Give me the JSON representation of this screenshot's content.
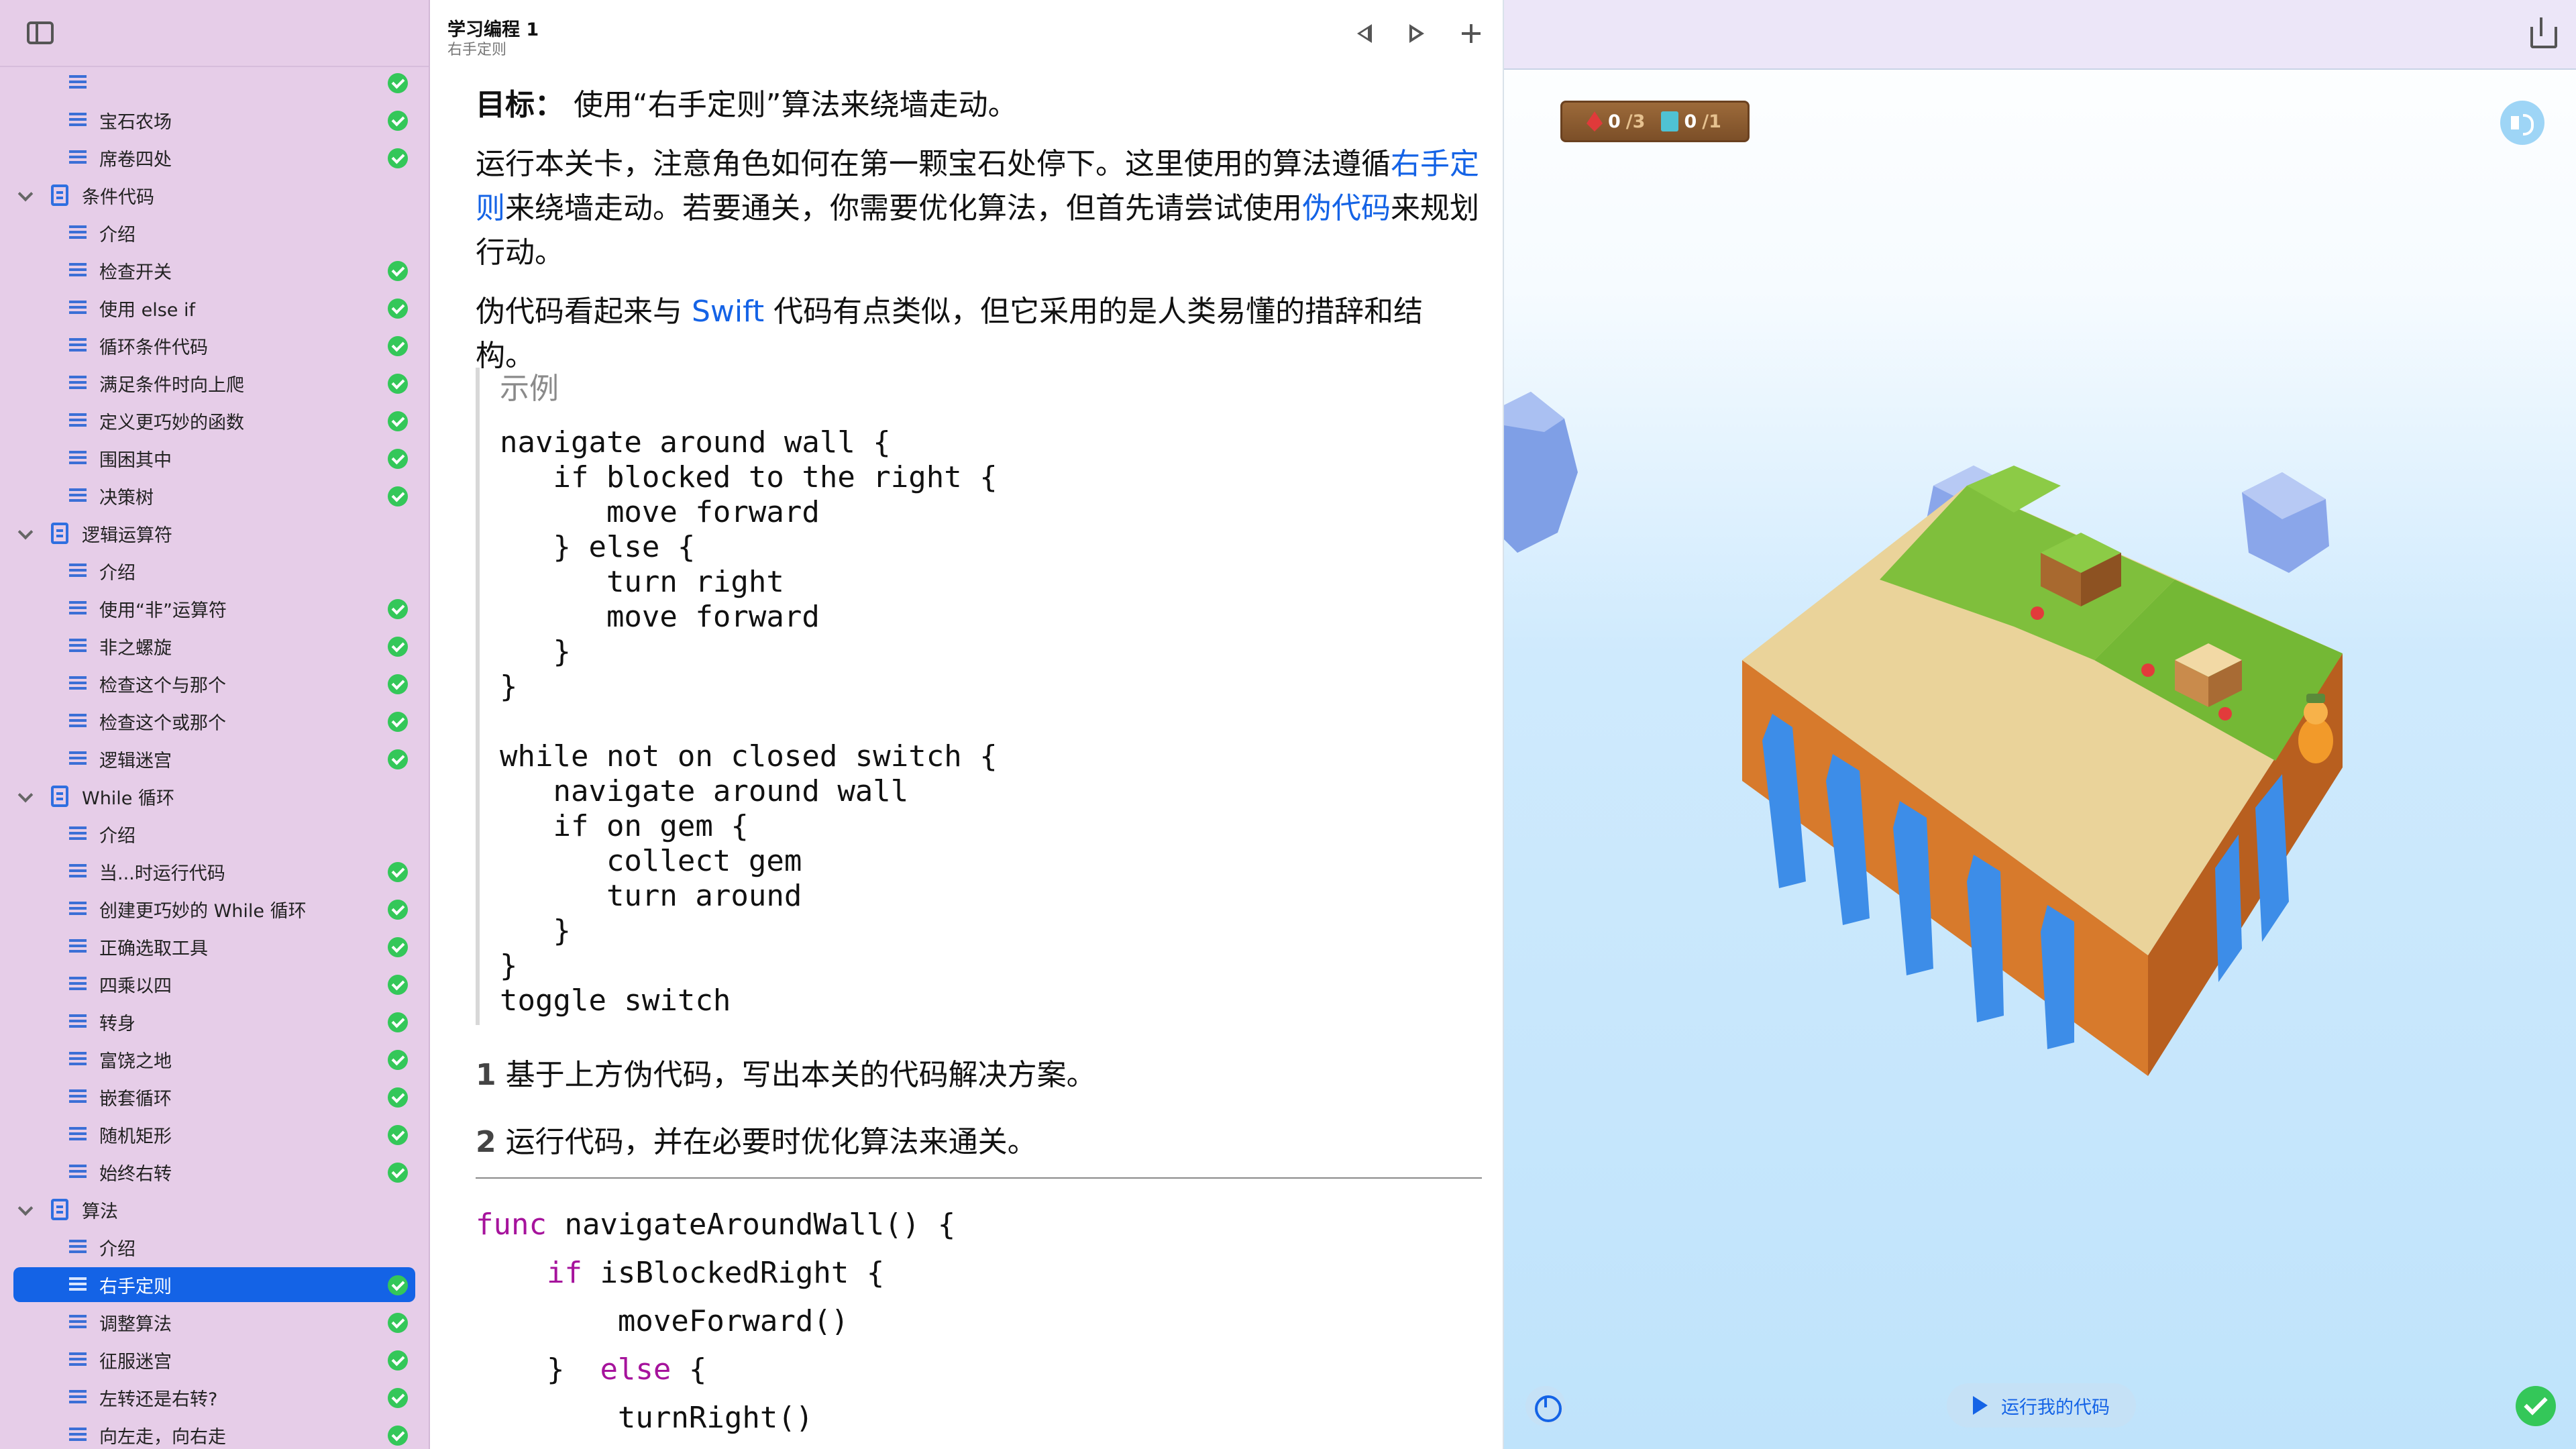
{
  "sidebar": {
    "toggle_icon": "sidebar-toggle-icon",
    "rows": [
      {
        "type": "page",
        "label": "",
        "done": true
      },
      {
        "type": "page",
        "label": "宝石农场",
        "done": true
      },
      {
        "type": "page",
        "label": "席卷四处",
        "done": true
      },
      {
        "type": "section",
        "label": "条件代码"
      },
      {
        "type": "page",
        "label": "介绍",
        "done": false
      },
      {
        "type": "page",
        "label": "检查开关",
        "done": true
      },
      {
        "type": "page",
        "label": "使用 else if",
        "done": true
      },
      {
        "type": "page",
        "label": "循环条件代码",
        "done": true
      },
      {
        "type": "page",
        "label": "满足条件时向上爬",
        "done": true
      },
      {
        "type": "page",
        "label": "定义更巧妙的函数",
        "done": true
      },
      {
        "type": "page",
        "label": "围困其中",
        "done": true
      },
      {
        "type": "page",
        "label": "决策树",
        "done": true
      },
      {
        "type": "section",
        "label": "逻辑运算符"
      },
      {
        "type": "page",
        "label": "介绍",
        "done": false
      },
      {
        "type": "page",
        "label": "使用“非”运算符",
        "done": true
      },
      {
        "type": "page",
        "label": "非之螺旋",
        "done": true
      },
      {
        "type": "page",
        "label": "检查这个与那个",
        "done": true
      },
      {
        "type": "page",
        "label": "检查这个或那个",
        "done": true
      },
      {
        "type": "page",
        "label": "逻辑迷宫",
        "done": true
      },
      {
        "type": "section",
        "label": "While 循环"
      },
      {
        "type": "page",
        "label": "介绍",
        "done": false
      },
      {
        "type": "page",
        "label": "当...时运行代码",
        "done": true
      },
      {
        "type": "page",
        "label": "创建更巧妙的 While 循环",
        "done": true
      },
      {
        "type": "page",
        "label": "正确选取工具",
        "done": true
      },
      {
        "type": "page",
        "label": "四乘以四",
        "done": true
      },
      {
        "type": "page",
        "label": "转身",
        "done": true
      },
      {
        "type": "page",
        "label": "富饶之地",
        "done": true
      },
      {
        "type": "page",
        "label": "嵌套循环",
        "done": true
      },
      {
        "type": "page",
        "label": "随机矩形",
        "done": true
      },
      {
        "type": "page",
        "label": "始终右转",
        "done": true
      },
      {
        "type": "section",
        "label": "算法"
      },
      {
        "type": "page",
        "label": "介绍",
        "done": false
      },
      {
        "type": "page",
        "label": "右手定则",
        "done": true,
        "selected": true
      },
      {
        "type": "page",
        "label": "调整算法",
        "done": true
      },
      {
        "type": "page",
        "label": "征服迷宫",
        "done": true
      },
      {
        "type": "page",
        "label": "左转还是右转?",
        "done": true
      },
      {
        "type": "page",
        "label": "向左走，向右走",
        "done": true
      }
    ]
  },
  "header": {
    "title": "学习编程 1",
    "subtitle": "右手定则",
    "prev_icon": "previous-page-icon",
    "next_icon": "next-page-icon",
    "add_icon": "plus-icon"
  },
  "prose": {
    "goal_label": "目标：",
    "goal_text": "使用“右手定则”算法来绕墙走动。",
    "p1_a": "运行本关卡，注意角色如何在第一颗宝石处停下。这里使用的算法遵循",
    "p1_link1": "右手定则",
    "p1_b": "来绕墙走动。若要通关，你需要优化算法，但首先请尝试使用",
    "p1_link2": "伪代码",
    "p1_c": "来规划行动。",
    "p2_a": "伪代码看起来与 ",
    "p2_link": "Swift",
    "p2_b": " 代码有点类似，但它采用的是人类易懂的措辞和结构。"
  },
  "example": {
    "title": "示例",
    "code": "navigate around wall {\n   if blocked to the right {\n      move forward\n   } else {\n      turn right\n      move forward\n   }\n}\n\nwhile not on closed switch {\n   navigate around wall\n   if on gem {\n      collect gem\n      turn around\n   }\n}\ntoggle switch"
  },
  "steps": [
    {
      "num": "1",
      "text": "基于上方伪代码，写出本关的代码解决方案。"
    },
    {
      "num": "2",
      "text": "运行代码，并在必要时优化算法来通关。"
    }
  ],
  "editor": {
    "line1_kw": "func",
    "line1_rest": " navigateAroundWall() {",
    "line2_indent": "    ",
    "line2_kw": "if",
    "line2_rest": " isBlockedRight {",
    "line3": "        moveForward()",
    "line4_a": "    }  ",
    "line4_kw": "else",
    "line4_b": " {",
    "line5": "        turnRight()"
  },
  "liveview": {
    "gems_collected": "0",
    "gems_total": "/3",
    "switches_on": "0",
    "switches_total": "/1",
    "gem_icon": "gem-icon",
    "switch_icon": "switch-icon",
    "sound_icon": "speaker-icon",
    "share_icon": "share-icon",
    "run_label": "运行我的代码",
    "run_icon": "play-icon",
    "speed_icon": "speedometer-icon",
    "complete_icon": "checkmark-icon"
  },
  "colors": {
    "accent": "#1463e6",
    "sidebar_bg": "#e6cde8",
    "success": "#34c759",
    "keyword": "#a6139c"
  }
}
